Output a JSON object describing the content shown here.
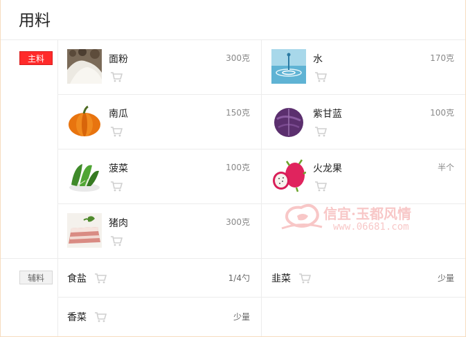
{
  "title": "用料",
  "main_tag": "主料",
  "aux_tag": "辅料",
  "main_items": [
    {
      "name": "面粉",
      "qty": "300克",
      "image": "flour"
    },
    {
      "name": "水",
      "qty": "170克",
      "image": "water"
    },
    {
      "name": "南瓜",
      "qty": "150克",
      "image": "pumpkin"
    },
    {
      "name": "紫甘蓝",
      "qty": "100克",
      "image": "purple-cabbage"
    },
    {
      "name": "菠菜",
      "qty": "100克",
      "image": "spinach"
    },
    {
      "name": "火龙果",
      "qty": "半个",
      "image": "dragon-fruit"
    },
    {
      "name": "猪肉",
      "qty": "300克",
      "image": "pork"
    }
  ],
  "aux_items": [
    {
      "name": "食盐",
      "qty": "1/4勺"
    },
    {
      "name": "韭菜",
      "qty": "少量"
    },
    {
      "name": "香菜",
      "qty": "少量"
    }
  ],
  "watermark": {
    "text": "信宜·玉都风情",
    "url": "www.06681.com"
  },
  "icons": {
    "cart": "shopping-cart-icon"
  },
  "colors": {
    "main_tag": "#ff2a2a",
    "aux_tag": "#f2f2f2",
    "border": "#f6dcbf"
  }
}
